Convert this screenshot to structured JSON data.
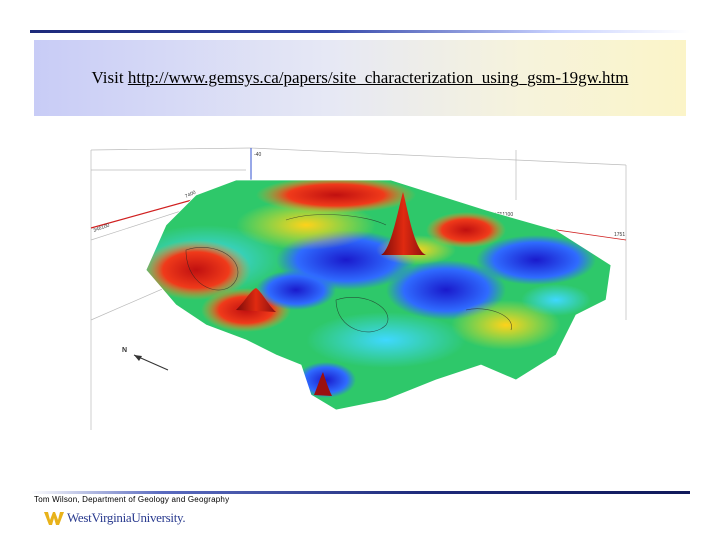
{
  "slide": {
    "visit_prefix": "Visit",
    "url": "http://www.gemsys.ca/papers/site_characterization_using_gsm-19gw.htm",
    "figure": {
      "north_label": "N",
      "axis_labels": [
        "-40",
        "1751300",
        "1751100",
        "1751",
        "3300",
        "7400",
        "346100"
      ]
    },
    "footer": "Tom Wilson, Department of Geology and Geography",
    "logo_text": "WestVirginiaUniversity."
  },
  "colors": {
    "title_left": "#c8ccf6",
    "title_right": "#fbf4c8",
    "rule": "#1d2a7a",
    "logo": "#2a3b8f"
  }
}
